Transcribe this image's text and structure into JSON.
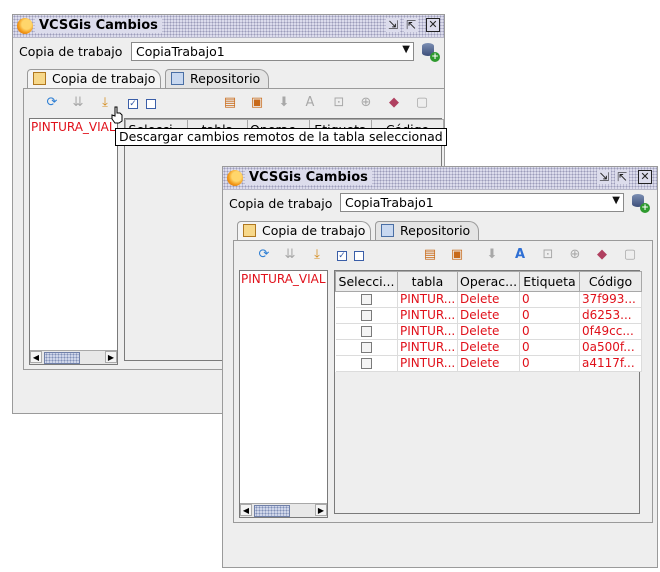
{
  "back_window": {
    "title": "VCSGis Cambios",
    "working_copy_label": "Copia de trabajo",
    "working_copy_value": "CopiaTrabajo1",
    "tabs": [
      {
        "label": "Copia de trabajo"
      },
      {
        "label": "Repositorio"
      }
    ],
    "tables_list": [
      "PINTURA_VIAL"
    ],
    "columns": [
      "Selecci...",
      "tabla",
      "Operac...",
      "Etiqueta",
      "Código"
    ],
    "tooltip": "Descargar cambios remotos de la tabla seleccionad"
  },
  "front_window": {
    "title": "VCSGis Cambios",
    "working_copy_label": "Copia de trabajo",
    "working_copy_value": "CopiaTrabajo1",
    "tabs": [
      {
        "label": "Copia de trabajo"
      },
      {
        "label": "Repositorio"
      }
    ],
    "tables_list": [
      "PINTURA_VIAL"
    ],
    "columns": [
      "Selecci...",
      "tabla",
      "Operac...",
      "Etiqueta",
      "Código"
    ],
    "rows": [
      {
        "selected": false,
        "table": "PINTUR...",
        "operation": "Delete",
        "label": "0",
        "code": "37f993..."
      },
      {
        "selected": false,
        "table": "PINTUR...",
        "operation": "Delete",
        "label": "0",
        "code": "d6253..."
      },
      {
        "selected": false,
        "table": "PINTUR...",
        "operation": "Delete",
        "label": "0",
        "code": "0f49cc..."
      },
      {
        "selected": false,
        "table": "PINTUR...",
        "operation": "Delete",
        "label": "0",
        "code": "0a500f..."
      },
      {
        "selected": false,
        "table": "PINTUR...",
        "operation": "Delete",
        "label": "0",
        "code": "a4117f..."
      }
    ]
  },
  "icons": [
    "app-icon",
    "minimize-icon",
    "maximize-icon",
    "close-icon",
    "refresh-icon",
    "download-multi-icon",
    "download-icon",
    "check-all-icon",
    "uncheck-all-icon",
    "commit-icon",
    "revert-icon",
    "arrow-down-icon",
    "text-icon",
    "zoom-icon",
    "center-icon",
    "eraser-icon",
    "report-icon"
  ],
  "colors": {
    "accent_red": "#e0101a",
    "title_bar": "#dcdcec"
  }
}
